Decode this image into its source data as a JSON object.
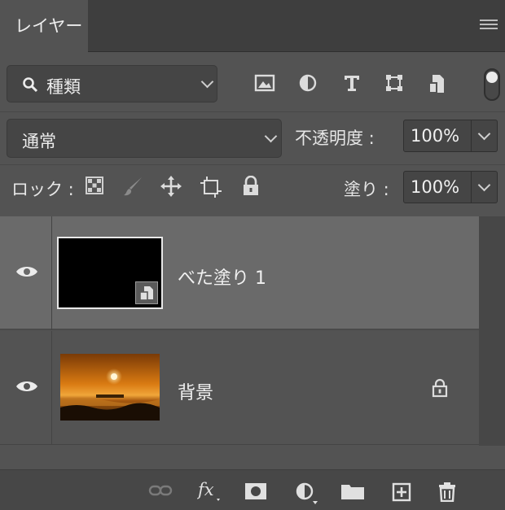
{
  "tab": {
    "label": "レイヤー"
  },
  "filter": {
    "label": "種類"
  },
  "blend": {
    "mode": "通常"
  },
  "opacity": {
    "label": "不透明度 :",
    "value": "100%"
  },
  "lock": {
    "label": "ロック :"
  },
  "fill": {
    "label": "塗り :",
    "value": "100%"
  },
  "layers": [
    {
      "name": "べた塗り 1",
      "selected": true,
      "visible": true,
      "kind": "fill"
    },
    {
      "name": "背景",
      "selected": false,
      "visible": true,
      "kind": "photo",
      "locked": true
    }
  ],
  "colors": {
    "panel_bg": "#535353",
    "selected_row": "#6a6a6a",
    "tabbar_bg": "#3e3e3e",
    "fill_color": "#000000"
  }
}
